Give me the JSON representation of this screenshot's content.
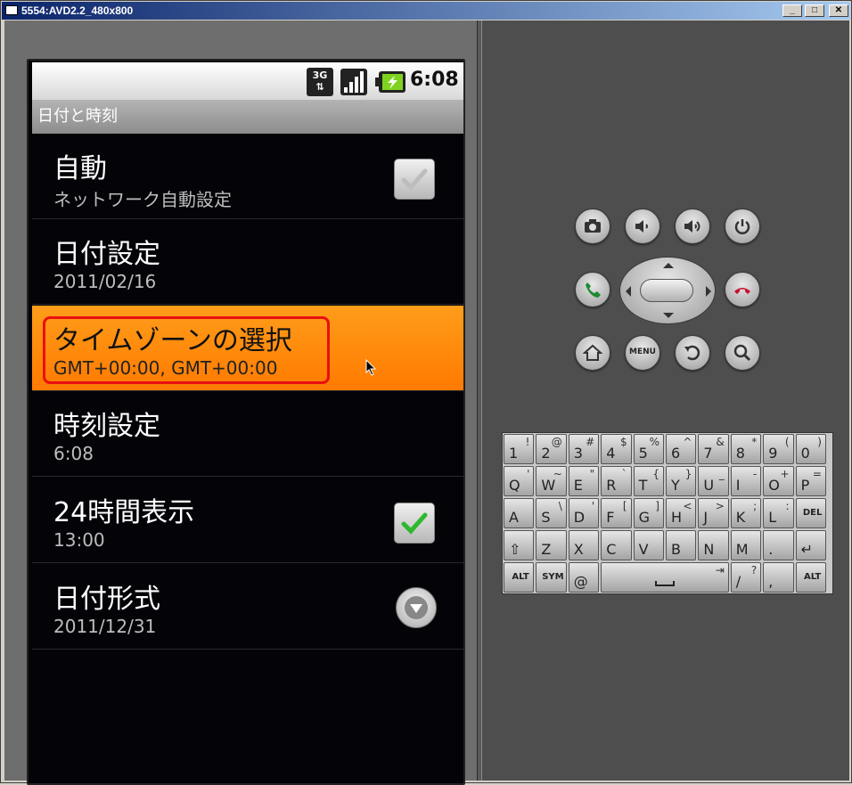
{
  "window": {
    "title": "5554:AVD2.2_480x800",
    "min": "_",
    "max": "□",
    "close": "✕"
  },
  "statusbar": {
    "network": "3G",
    "time": "6:08"
  },
  "app": {
    "title": "日付と時刻"
  },
  "prefs": [
    {
      "title": "自動",
      "summary": "ネットワーク自動設定",
      "widget": "checkbox",
      "checked": true,
      "enabled": false
    },
    {
      "title": "日付設定",
      "summary": "2011/02/16"
    },
    {
      "title": "タイムゾーンの選択",
      "summary": "GMT+00:00, GMT+00:00",
      "selected": true
    },
    {
      "title": "時刻設定",
      "summary": "6:08"
    },
    {
      "title": "24時間表示",
      "summary": "13:00",
      "widget": "checkbox",
      "checked": true,
      "enabled": true
    },
    {
      "title": "日付形式",
      "summary": "2011/12/31",
      "widget": "dropdown"
    }
  ],
  "hardware": {
    "menu_label": "MENU",
    "icons": [
      "camera-icon",
      "volume-down-icon",
      "volume-up-icon",
      "power-icon",
      "call-icon",
      "end-call-icon",
      "home-icon",
      "menu-icon",
      "back-icon",
      "search-icon"
    ]
  },
  "keyboard": {
    "rows": [
      [
        {
          "m": "1",
          "a": "!"
        },
        {
          "m": "2",
          "a": "@"
        },
        {
          "m": "3",
          "a": "#"
        },
        {
          "m": "4",
          "a": "$"
        },
        {
          "m": "5",
          "a": "%"
        },
        {
          "m": "6",
          "a": "^"
        },
        {
          "m": "7",
          "a": "&"
        },
        {
          "m": "8",
          "a": "*"
        },
        {
          "m": "9",
          "a": "("
        },
        {
          "m": "0",
          "a": ")"
        }
      ],
      [
        {
          "m": "Q",
          "a": "'"
        },
        {
          "m": "W",
          "a": "~"
        },
        {
          "m": "E",
          "a": "\""
        },
        {
          "m": "R",
          "a": "`"
        },
        {
          "m": "T",
          "a": "{"
        },
        {
          "m": "Y",
          "a": "}"
        },
        {
          "m": "U",
          "a": "_"
        },
        {
          "m": "I",
          "a": "-"
        },
        {
          "m": "O",
          "a": "+"
        },
        {
          "m": "P",
          "a": "="
        }
      ],
      [
        {
          "m": "A",
          "a": ""
        },
        {
          "m": "S",
          "a": "\\"
        },
        {
          "m": "D",
          "a": "'"
        },
        {
          "m": "F",
          "a": "["
        },
        {
          "m": "G",
          "a": "]"
        },
        {
          "m": "H",
          "a": "<"
        },
        {
          "m": "J",
          "a": ">"
        },
        {
          "m": "K",
          "a": ";"
        },
        {
          "m": "L",
          "a": ":"
        },
        {
          "m": "",
          "a": "",
          "small": "DEL"
        }
      ],
      [
        {
          "m": "⇧",
          "a": ""
        },
        {
          "m": "Z",
          "a": ""
        },
        {
          "m": "X",
          "a": ""
        },
        {
          "m": "C",
          "a": ""
        },
        {
          "m": "V",
          "a": ""
        },
        {
          "m": "B",
          "a": ""
        },
        {
          "m": "N",
          "a": ""
        },
        {
          "m": "M",
          "a": ""
        },
        {
          "m": ".",
          "a": ""
        },
        {
          "m": "↵",
          "a": ""
        }
      ],
      [
        {
          "m": "",
          "a": "",
          "small": "ALT"
        },
        {
          "m": "",
          "a": "",
          "small": "SYM"
        },
        {
          "m": "@",
          "a": ""
        },
        {
          "m": "",
          "a": "⇥",
          "wide": true
        },
        {
          "m": "/",
          "a": "?"
        },
        {
          "m": ",",
          "a": ""
        },
        {
          "m": "",
          "a": "",
          "small": "ALT"
        }
      ]
    ]
  }
}
